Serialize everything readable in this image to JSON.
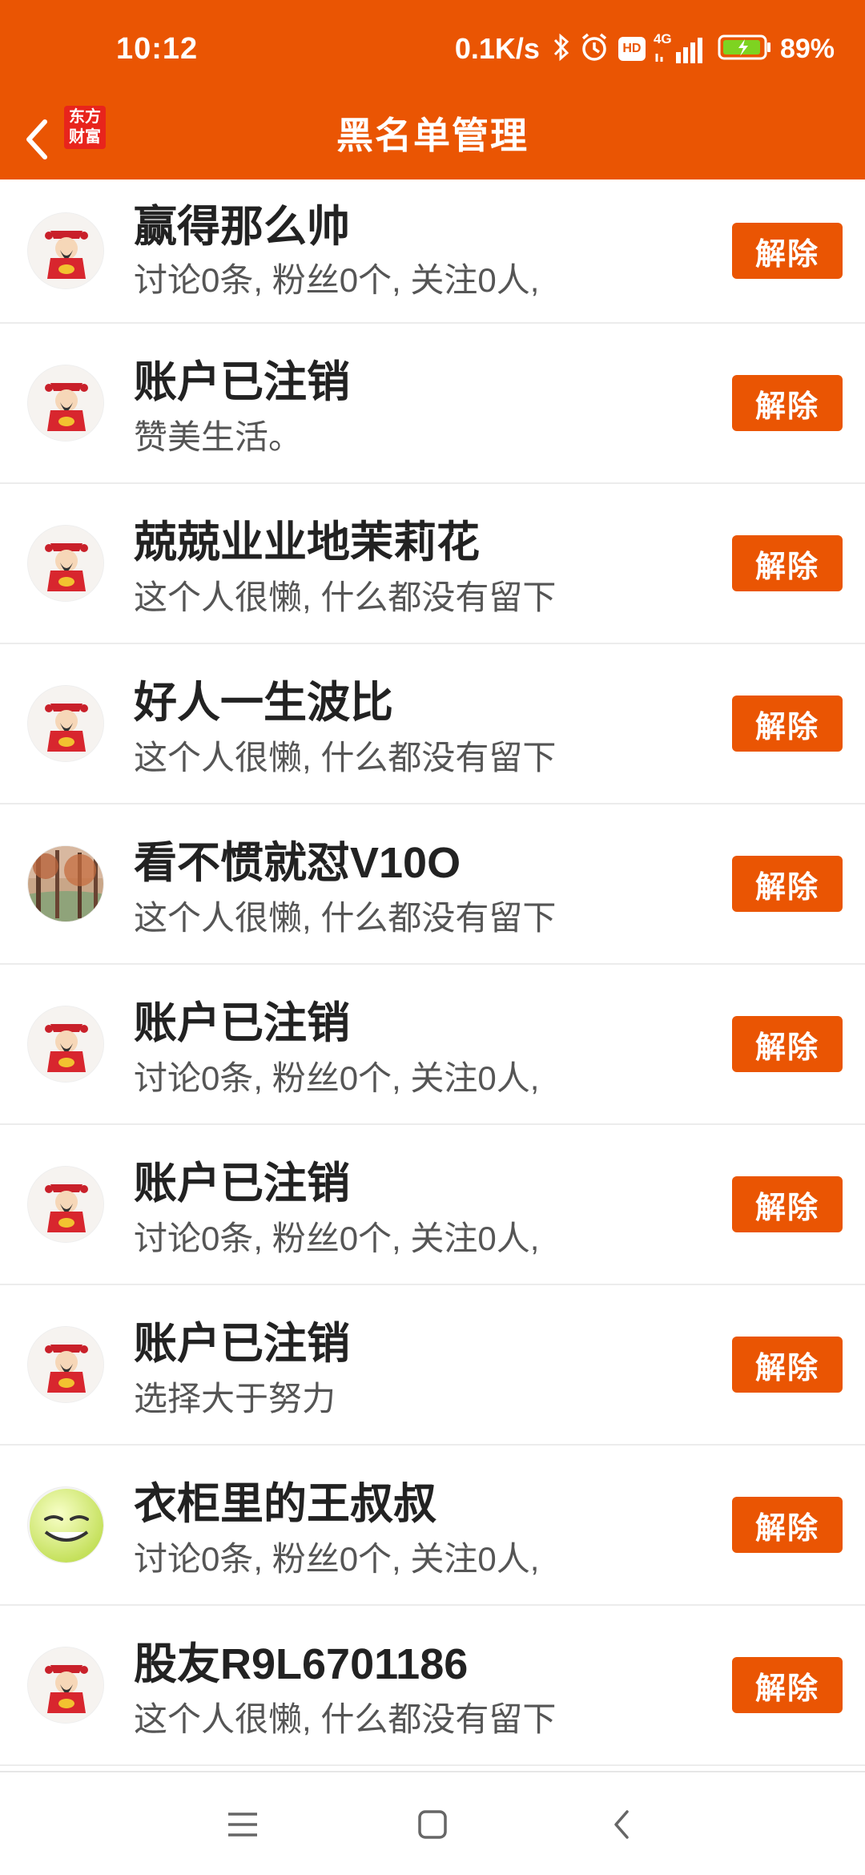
{
  "status_bar": {
    "time": "10:12",
    "network_speed": "0.1K/s",
    "network_type": "4G",
    "hd_badge": "HD",
    "battery_percent": "89%",
    "icons": [
      "bluetooth-icon",
      "alarm-icon",
      "hd-icon",
      "signal-icon",
      "battery-icon"
    ]
  },
  "header": {
    "title": "黑名单管理",
    "logo_line1": "东方",
    "logo_line2": "财富",
    "back_icon": "chevron-left-icon"
  },
  "colors": {
    "accent": "#ea5503",
    "logo_red": "#e8241c",
    "name_text": "#222222",
    "desc_text": "#555555"
  },
  "blacklist": [
    {
      "name": "赢得那么帅",
      "desc": "讨论0条, 粉丝0个, 关注0人,",
      "avatar": "caishen-avatar",
      "button": "解除"
    },
    {
      "name": "账户已注销",
      "desc": "赞美生活。",
      "avatar": "caishen-avatar",
      "button": "解除"
    },
    {
      "name": "兢兢业业地茉莉花",
      "desc": "这个人很懒, 什么都没有留下",
      "avatar": "caishen-avatar",
      "button": "解除"
    },
    {
      "name": "好人一生波比",
      "desc": "这个人很懒, 什么都没有留下",
      "avatar": "caishen-avatar",
      "button": "解除"
    },
    {
      "name": "看不惯就怼V10O",
      "desc": "这个人很懒, 什么都没有留下",
      "avatar": "photo-avatar",
      "button": "解除"
    },
    {
      "name": "账户已注销",
      "desc": "讨论0条, 粉丝0个, 关注0人,",
      "avatar": "caishen-avatar",
      "button": "解除"
    },
    {
      "name": "账户已注销",
      "desc": "讨论0条, 粉丝0个, 关注0人,",
      "avatar": "caishen-avatar",
      "button": "解除"
    },
    {
      "name": "账户已注销",
      "desc": "选择大于努力",
      "avatar": "caishen-avatar",
      "button": "解除"
    },
    {
      "name": "衣柜里的王叔叔",
      "desc": "讨论0条, 粉丝0个, 关注0人,",
      "avatar": "smiley-avatar",
      "button": "解除"
    },
    {
      "name": "股友R9L6701186",
      "desc": "这个人很懒, 什么都没有留下",
      "avatar": "caishen-avatar",
      "button": "解除"
    }
  ],
  "nav_bar": {
    "buttons": [
      "menu-icon",
      "home-icon",
      "back-icon"
    ]
  }
}
